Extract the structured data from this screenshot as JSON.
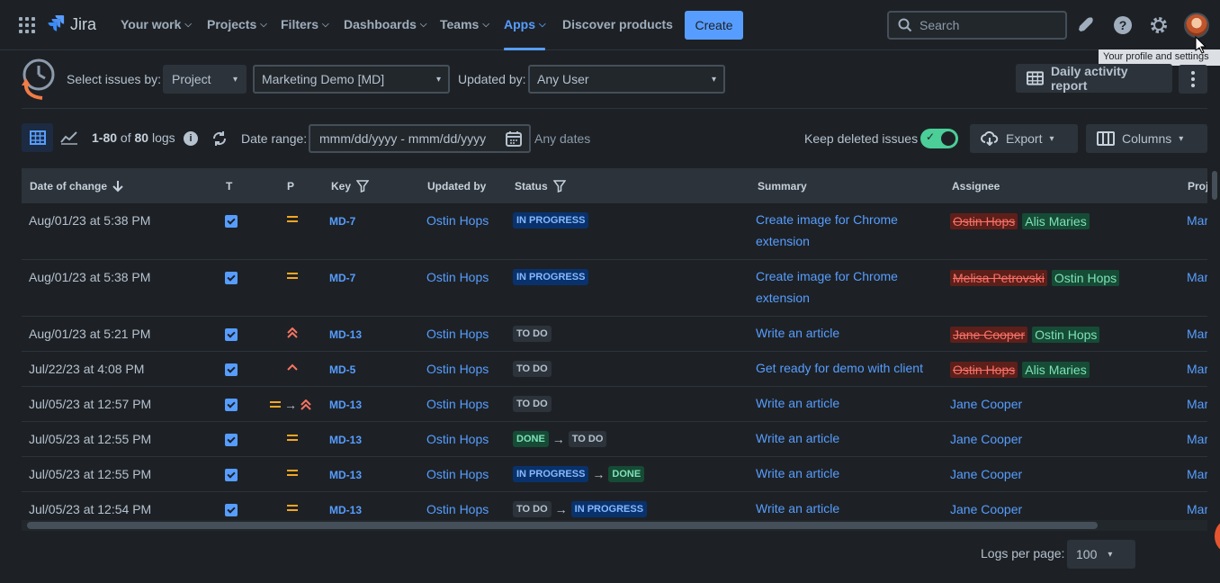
{
  "nav": {
    "logo": "Jira",
    "items": [
      "Your work",
      "Projects",
      "Filters",
      "Dashboards",
      "Teams",
      "Apps",
      "Discover products"
    ],
    "create": "Create",
    "search_placeholder": "Search",
    "tooltip": "Your profile and settings"
  },
  "filters": {
    "select_label": "Select issues by:",
    "select_value": "Project",
    "project_value": "Marketing Demo [MD]",
    "updated_label": "Updated by:",
    "updated_value": "Any User",
    "report_button": "Daily activity report"
  },
  "toolbar": {
    "range": "1-80",
    "of": "of",
    "total": "80",
    "logs": "logs",
    "date_label": "Date range:",
    "date_placeholder": "mmm/dd/yyyy - mmm/dd/yyyy",
    "any_dates": "Any dates",
    "keep_deleted": "Keep deleted issues",
    "export": "Export",
    "columns": "Columns"
  },
  "table": {
    "headers": {
      "date": "Date of change",
      "type": "T",
      "priority": "P",
      "key": "Key",
      "updated_by": "Updated by",
      "status": "Status",
      "summary": "Summary",
      "assignee": "Assignee",
      "project": "Proj"
    },
    "rows": [
      {
        "date": "Aug/01/23 at 5:38 PM",
        "key": "MD-7",
        "updated_by": "Ostin Hops",
        "status_from": "IN PROGRESS",
        "status_to": "",
        "summary": "Create image for Chrome extension",
        "assignee_old": "Ostin Hops",
        "assignee": "Alis Maries",
        "project": "Mar"
      },
      {
        "date": "Aug/01/23 at 5:38 PM",
        "key": "MD-7",
        "updated_by": "Ostin Hops",
        "status_from": "IN PROGRESS",
        "status_to": "",
        "summary": "Create image for Chrome extension",
        "assignee_old": "Melisa Petrovski",
        "assignee": "Ostin Hops",
        "project": "Mar"
      },
      {
        "date": "Aug/01/23 at 5:21 PM",
        "key": "MD-13",
        "updated_by": "Ostin Hops",
        "status_from": "TO DO",
        "status_to": "",
        "summary": "Write an article",
        "assignee_old": "Jane Cooper",
        "assignee": "Ostin Hops",
        "project": "Mar"
      },
      {
        "date": "Jul/22/23 at 4:08 PM",
        "key": "MD-5",
        "updated_by": "Ostin Hops",
        "status_from": "TO DO",
        "status_to": "",
        "summary": "Get ready for demo with client",
        "assignee_old": "Ostin Hops",
        "assignee": "Alis Maries",
        "project": "Mar"
      },
      {
        "date": "Jul/05/23 at 12:57 PM",
        "key": "MD-13",
        "updated_by": "Ostin Hops",
        "status_from": "TO DO",
        "status_to": "",
        "summary": "Write an article",
        "assignee_old": "",
        "assignee": "Jane Cooper",
        "project": "Mar"
      },
      {
        "date": "Jul/05/23 at 12:55 PM",
        "key": "MD-13",
        "updated_by": "Ostin Hops",
        "status_from": "DONE",
        "status_to": "TO DO",
        "summary": "Write an article",
        "assignee_old": "",
        "assignee": "Jane Cooper",
        "project": "Mar"
      },
      {
        "date": "Jul/05/23 at 12:55 PM",
        "key": "MD-13",
        "updated_by": "Ostin Hops",
        "status_from": "IN PROGRESS",
        "status_to": "DONE",
        "summary": "Write an article",
        "assignee_old": "",
        "assignee": "Jane Cooper",
        "project": "Mar"
      },
      {
        "date": "Jul/05/23 at 12:54 PM",
        "key": "MD-13",
        "updated_by": "Ostin Hops",
        "status_from": "TO DO",
        "status_to": "IN PROGRESS",
        "summary": "Write an article",
        "assignee_old": "",
        "assignee": "Jane Cooper",
        "project": "Mar"
      }
    ]
  },
  "footer": {
    "per_page_label": "Logs per page:",
    "per_page_value": "100"
  },
  "colors": {
    "accent": "#579dff",
    "background": "#1d2125",
    "priority_medium": "#f5a623",
    "priority_high": "#f87462",
    "toggle_on": "#4bce97"
  }
}
